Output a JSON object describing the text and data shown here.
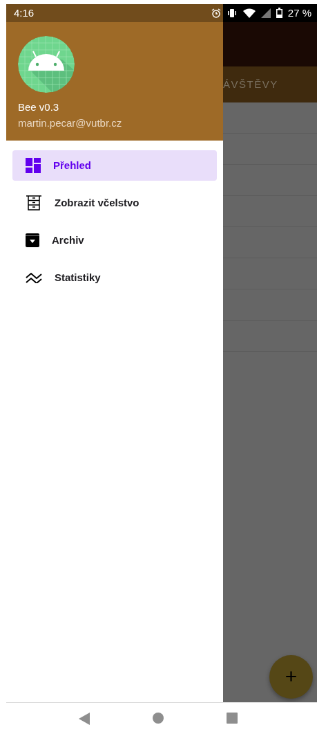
{
  "status_bar": {
    "time": "4:16",
    "battery": "27 %"
  },
  "drawer": {
    "app_name": "Bee v0.3",
    "email": "martin.pecar@vutbr.cz",
    "items": [
      {
        "label": "Přehled",
        "kind": "dashboard",
        "selected": true
      },
      {
        "label": "Zobrazit včelstvo",
        "kind": "drawers",
        "selected": false
      },
      {
        "label": "Archiv",
        "kind": "archive",
        "selected": false
      },
      {
        "label": "Statistiky",
        "kind": "trending",
        "selected": false
      }
    ]
  },
  "background": {
    "tab": "ÁVŠTĚVY",
    "fab": "+"
  }
}
